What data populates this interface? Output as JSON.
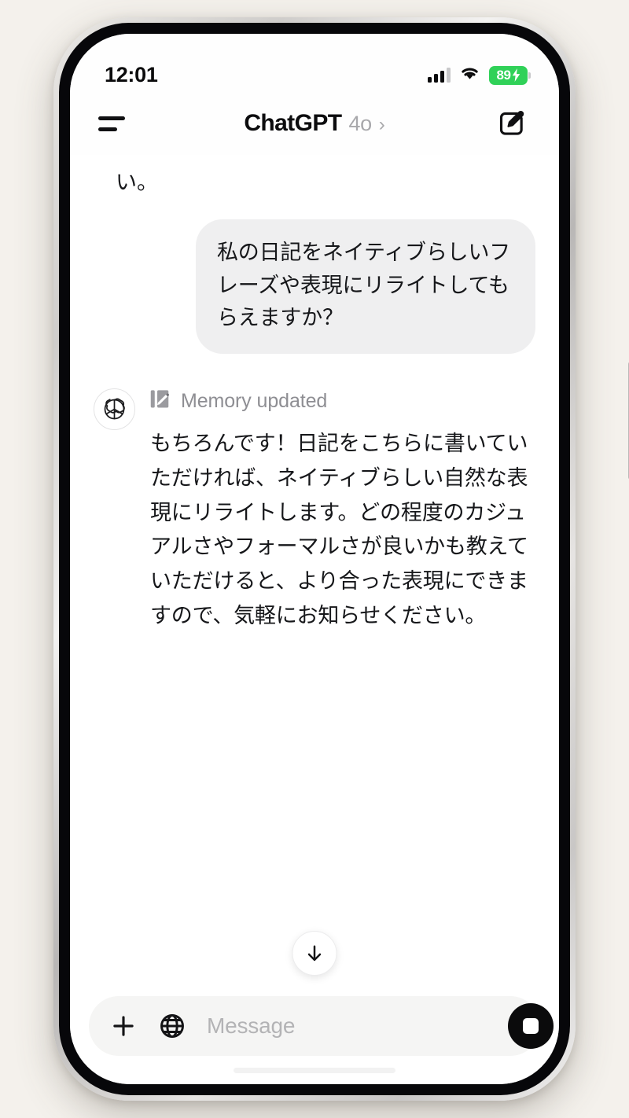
{
  "status_bar": {
    "time": "12:01",
    "cellular_icon": "signal-bars-icon",
    "wifi_icon": "wifi-icon",
    "battery_level": "89",
    "battery_charging": true,
    "battery_color": "#30d158"
  },
  "header": {
    "menu_icon": "hamburger-menu-icon",
    "title": "ChatGPT",
    "model": "4o",
    "chevron": "›",
    "compose_icon": "compose-new-chat-icon"
  },
  "conversation": {
    "clipped_message": "い。",
    "user_message": "私の日記をネイティブらしいフレーズや表現にリライトしてもらえますか？",
    "assistant": {
      "avatar_icon": "openai-logo-icon",
      "memory_icon": "memory-updated-icon",
      "memory_label": "Memory updated",
      "text": "もちろんです！日記をこちらに書いていただければ、ネイティブらしい自然な表現にリライトします。どの程度のカジュアルさやフォーマルさが良いかも教えていただけると、より合った表現にできますので、気軽にお知らせください。"
    },
    "scroll_bottom_icon": "arrow-down-icon"
  },
  "composer": {
    "attach_icon": "plus-icon",
    "browse_icon": "globe-icon",
    "input_value": "",
    "input_placeholder": "Message",
    "stop_icon": "stop-square-icon"
  },
  "colors": {
    "page_background": "#f4f1ec",
    "user_bubble": "#efeff0",
    "composer_background": "#f5f5f4",
    "accent_black": "#0b0b0c",
    "muted_gray": "#8e8e93"
  }
}
